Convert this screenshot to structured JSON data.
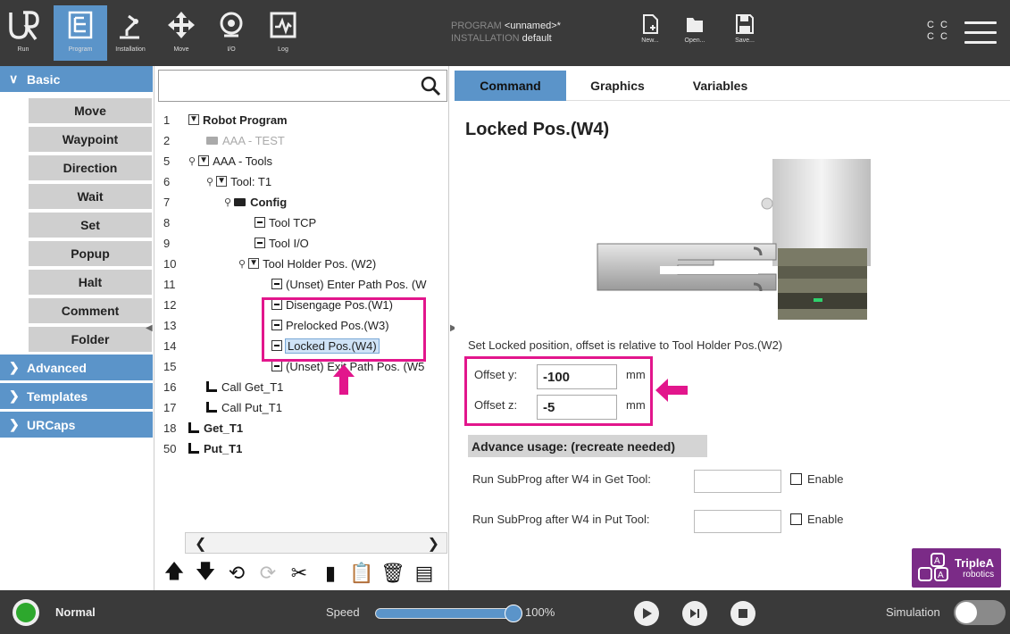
{
  "nav": {
    "run": "Run",
    "program": "Program",
    "installation": "Installation",
    "move": "Move",
    "io": "I/O",
    "log": "Log"
  },
  "program_info": {
    "program_label": "PROGRAM",
    "program_value": "<unnamed>*",
    "installation_label": "INSTALLATION",
    "installation_value": "default"
  },
  "file": {
    "new": "New...",
    "open": "Open...",
    "save": "Save..."
  },
  "cc": {
    "line1": "C C",
    "line2": "C C"
  },
  "palette": {
    "basic": "Basic",
    "items": [
      "Move",
      "Waypoint",
      "Direction",
      "Wait",
      "Set",
      "Popup",
      "Halt",
      "Comment",
      "Folder"
    ],
    "advanced": "Advanced",
    "templates": "Templates",
    "urcaps": "URCaps"
  },
  "tree": {
    "rows": [
      {
        "ln": "1",
        "text": "Robot Program"
      },
      {
        "ln": "2",
        "text": "AAA - TEST"
      },
      {
        "ln": "5",
        "text": "AAA - Tools"
      },
      {
        "ln": "6",
        "text": "Tool: T1"
      },
      {
        "ln": "7",
        "text": "Config"
      },
      {
        "ln": "8",
        "text": "Tool TCP"
      },
      {
        "ln": "9",
        "text": "Tool I/O"
      },
      {
        "ln": "10",
        "text": "Tool Holder Pos. (W2)"
      },
      {
        "ln": "11",
        "text": "(Unset) Enter Path Pos. (W"
      },
      {
        "ln": "12",
        "text": "Disengage Pos.(W1)"
      },
      {
        "ln": "13",
        "text": "Prelocked Pos.(W3)"
      },
      {
        "ln": "14",
        "text": "Locked Pos.(W4)"
      },
      {
        "ln": "15",
        "text": "(Unset) Exit Path Pos. (W5"
      },
      {
        "ln": "16",
        "text": "Call Get_T1"
      },
      {
        "ln": "17",
        "text": "Call Put_T1"
      },
      {
        "ln": "18",
        "text": "Get_T1"
      },
      {
        "ln": "50",
        "text": "Put_T1"
      }
    ]
  },
  "tabs": {
    "command": "Command",
    "graphics": "Graphics",
    "variables": "Variables"
  },
  "detail": {
    "title": "Locked Pos.(W4)",
    "description": "Set Locked position, offset is relative to Tool Holder Pos.(W2)",
    "offset_y_label": "Offset y:",
    "offset_y_value": "-100",
    "offset_z_label": "Offset z:",
    "offset_z_value": "-5",
    "unit": "mm",
    "advanced_header": "Advance usage: (recreate needed)",
    "run_get_label": "Run SubProg after W4 in Get Tool:",
    "run_put_label": "Run SubProg after W4 in Put Tool:",
    "enable": "Enable"
  },
  "logo": {
    "line1": "TripleA",
    "line2": "robotics"
  },
  "footer": {
    "status": "Normal",
    "speed_label": "Speed",
    "speed_value": "100%",
    "speed_fraction": 1.0,
    "simulation": "Simulation"
  },
  "colors": {
    "accent": "#5b94c9",
    "highlight": "#e2168c",
    "topbar": "#3a3a3a"
  }
}
